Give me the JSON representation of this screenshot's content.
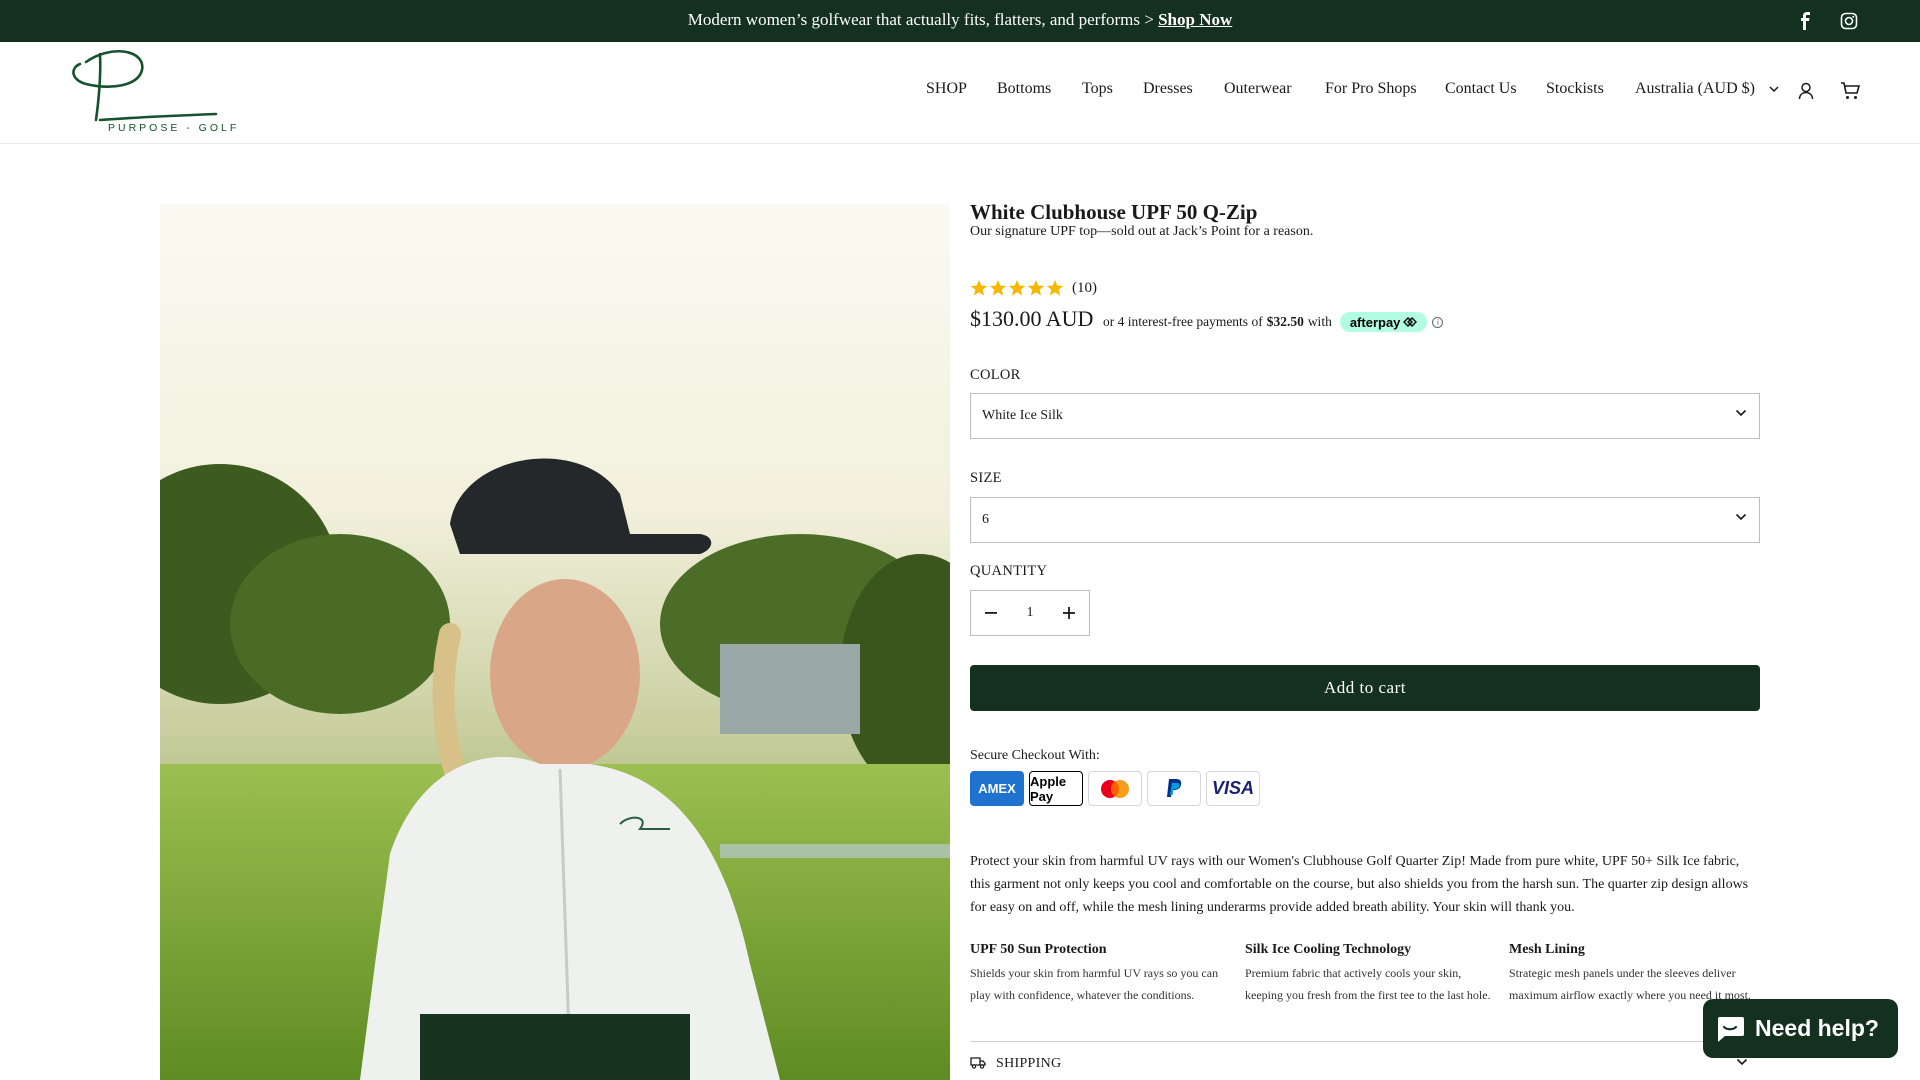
{
  "announcement": {
    "text": "Modern women’s golfwear that actually fits, flatters, and performs >",
    "link": "Shop Now"
  },
  "social": [
    "facebook-icon",
    "instagram-icon"
  ],
  "brand": {
    "logo_letter": "P",
    "logo_text": "PURPOSE - GOLF"
  },
  "nav": [
    "SHOP",
    "Bottoms",
    "Tops",
    "Dresses",
    "Outerwear",
    "For Pro Shops",
    "Contact Us",
    "Stockists",
    "Australia (AUD $)"
  ],
  "header_icons": [
    "account-icon",
    "cart-icon"
  ],
  "product": {
    "title": "White Clubhouse UPF 50 Q-Zip",
    "subtitle": "Our signature UPF top—sold out at Jack’s Point for a reason.",
    "rating": 5,
    "rating_count": "(10)",
    "price": "$130.00 AUD",
    "installments_prefix": "or 4 interest-free payments of",
    "installments_amount": "$32.50",
    "installments_suffix": "with",
    "afterpay_label": "afterpay",
    "color_label": "COLOR",
    "color_value": "White Ice Silk",
    "size_label": "SIZE",
    "size_value": "6",
    "quantity_label": "QUANTITY",
    "quantity_value": "1",
    "add_to_cart": "Add to cart",
    "secure_checkout": "Secure Checkout With:",
    "payment_methods": [
      "AMEX",
      "Apple Pay",
      "Mastercard",
      "PayPal",
      "VISA"
    ],
    "description": "Protect your skin from harmful UV rays with our Women's Clubhouse Golf Quarter Zip! Made from pure white, UPF 50+ Silk Ice fabric, this garment not only keeps you cool and comfortable on the course, but also shields you from the harsh sun. The quarter zip design allows for easy on and off, while the mesh lining underarms provide added breath ability. Your skin will thank you.",
    "features": [
      {
        "title": "UPF 50 Sun Protection",
        "text": "Shields your skin from harmful UV rays so you can play with confidence, whatever the conditions."
      },
      {
        "title": "Silk Ice Cooling Technology",
        "text": "Premium fabric that actively cools your skin, keeping you fresh from the first tee to the last hole."
      },
      {
        "title": "Mesh Lining",
        "text": "Strategic mesh panels under the sleeves deliver maximum airflow exactly where you need it most."
      }
    ],
    "shipping_label": "SHIPPING"
  },
  "help_button": "Need help?",
  "colors": {
    "brand_green": "#14301f",
    "star": "#f5b800",
    "afterpay": "#b2fce4"
  }
}
